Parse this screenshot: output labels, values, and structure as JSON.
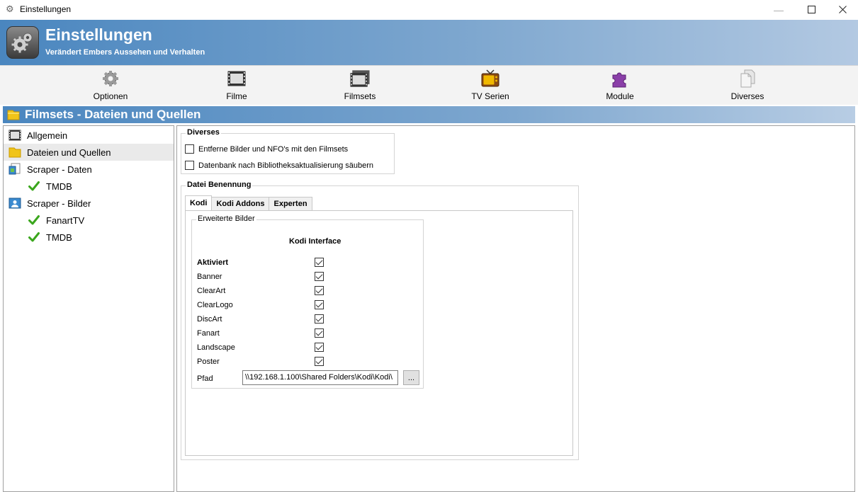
{
  "window": {
    "title": "Einstellungen",
    "controls": {
      "minimize": "—",
      "maximize": "☐",
      "close": "✕"
    }
  },
  "banner": {
    "title": "Einstellungen",
    "subtitle": "Verändert Embers Aussehen und Verhalten",
    "icon": "gear-icon"
  },
  "toolbar": {
    "items": [
      {
        "label": "Optionen",
        "icon": "gear-icon"
      },
      {
        "label": "Filme",
        "icon": "film-icon"
      },
      {
        "label": "Filmsets",
        "icon": "filmset-icon"
      },
      {
        "label": "TV Serien",
        "icon": "tv-icon"
      },
      {
        "label": "Module",
        "icon": "puzzle-icon"
      },
      {
        "label": "Diverses",
        "icon": "documents-icon"
      }
    ]
  },
  "section": {
    "title": "Filmsets - Dateien und Quellen",
    "icon": "folder-icon"
  },
  "tree": {
    "items": [
      {
        "label": "Allgemein",
        "icon": "film-icon",
        "level": 0,
        "selected": false
      },
      {
        "label": "Dateien und Quellen",
        "icon": "folder-icon",
        "level": 0,
        "selected": true
      },
      {
        "label": "Scraper - Daten",
        "icon": "data-scraper-icon",
        "level": 0,
        "selected": false
      },
      {
        "label": "TMDB",
        "icon": "checkmark-icon",
        "level": 1,
        "selected": false
      },
      {
        "label": "Scraper - Bilder",
        "icon": "image-scraper-icon",
        "level": 0,
        "selected": false
      },
      {
        "label": "FanartTV",
        "icon": "checkmark-icon",
        "level": 1,
        "selected": false
      },
      {
        "label": "TMDB",
        "icon": "checkmark-icon",
        "level": 1,
        "selected": false
      }
    ]
  },
  "diverses": {
    "title": "Diverses",
    "options": [
      {
        "label": "Entferne Bilder und NFO's mit den Filmsets",
        "checked": false
      },
      {
        "label": "Datenbank nach Bibliotheksaktualisierung säubern",
        "checked": false
      }
    ]
  },
  "naming": {
    "title": "Datei Benennung",
    "tabs": [
      {
        "label": "Kodi",
        "active": true
      },
      {
        "label": "Kodi Addons",
        "active": false
      },
      {
        "label": "Experten",
        "active": false
      }
    ],
    "extended": {
      "title": "Erweiterte Bilder",
      "column_header": "Kodi Interface",
      "rows": [
        {
          "label": "Aktiviert",
          "checked": true,
          "bold": true
        },
        {
          "label": "Banner",
          "checked": true,
          "bold": false
        },
        {
          "label": "ClearArt",
          "checked": true,
          "bold": false
        },
        {
          "label": "ClearLogo",
          "checked": true,
          "bold": false
        },
        {
          "label": "DiscArt",
          "checked": true,
          "bold": false
        },
        {
          "label": "Fanart",
          "checked": true,
          "bold": false
        },
        {
          "label": "Landscape",
          "checked": true,
          "bold": false
        },
        {
          "label": "Poster",
          "checked": true,
          "bold": false
        }
      ],
      "path_label": "Pfad",
      "path_value": "\\\\192.168.1.100\\Shared Folders\\Kodi\\Kodi\\",
      "browse_label": "..."
    }
  }
}
